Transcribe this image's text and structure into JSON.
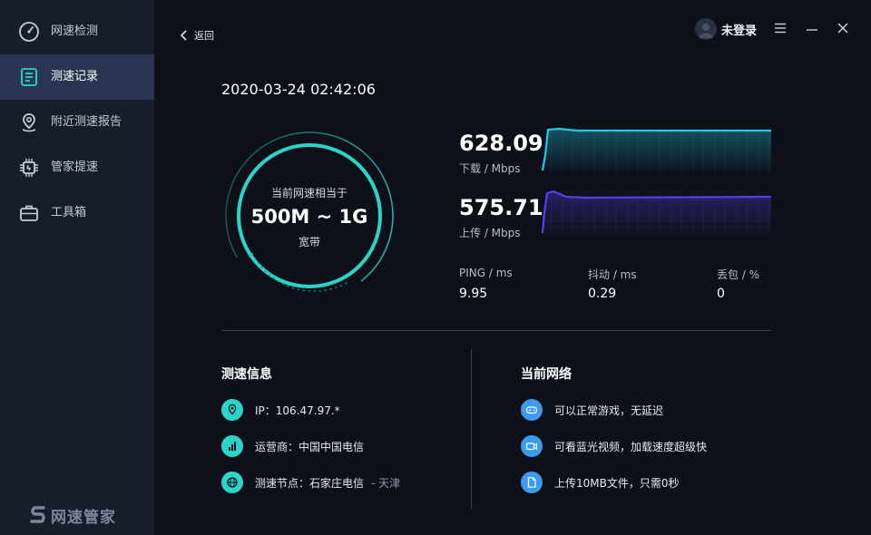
{
  "sidebar": {
    "items": [
      {
        "label": "网速检测",
        "icon": "speedometer-icon"
      },
      {
        "label": "测速记录",
        "icon": "record-list-icon",
        "active": true
      },
      {
        "label": "附近测速报告",
        "icon": "location-pin-icon"
      },
      {
        "label": "管家提速",
        "icon": "chip-icon"
      },
      {
        "label": "工具箱",
        "icon": "toolbox-icon"
      }
    ],
    "brand": "网速管家"
  },
  "header": {
    "back_label": "返回",
    "user_label": "未登录"
  },
  "result": {
    "datetime": "2020-03-24 02:42:06",
    "gauge_line1": "当前网速相当于",
    "gauge_line2": "500M ~ 1G",
    "gauge_line3": "宽带",
    "download": {
      "value": "628.09",
      "unit": "下载 / Mbps"
    },
    "upload": {
      "value": "575.71",
      "unit": "上传 / Mbps"
    },
    "metrics": [
      {
        "label": "PING / ms",
        "value": "9.95"
      },
      {
        "label": "抖动 / ms",
        "value": "0.29"
      },
      {
        "label": "丢包 / %",
        "value": "0"
      }
    ]
  },
  "speed_info": {
    "title": "测速信息",
    "ip": "IP：106.47.97.*",
    "isp": "运营商：中国中国电信",
    "node": "测速节点：石家庄电信",
    "node_city": "- 天津"
  },
  "network": {
    "title": "当前网络",
    "items": [
      "可以正常游戏，无延迟",
      "可看蓝光视频，加载速度超级快",
      "上传10MB文件，只需0秒"
    ]
  },
  "colors": {
    "sidebar_bg": "#181d2c",
    "active_bg": "#2a3552",
    "main_bg": "#0d1019",
    "teal": "#2ad5c8",
    "download_line": "#22c8e8",
    "upload_line": "#5b3cf0",
    "blue_icon": "#3a9cf0"
  }
}
